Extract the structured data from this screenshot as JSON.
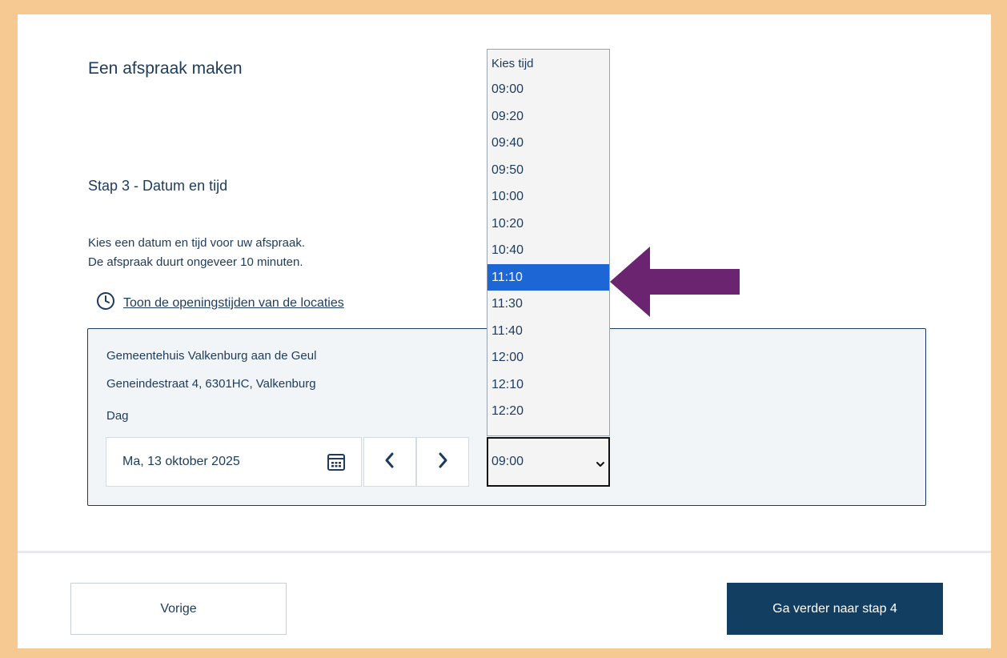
{
  "page": {
    "title": "Een afspraak maken",
    "step_title": "Stap 3 - Datum en tijd",
    "intro_line1": "Kies een datum en tijd voor uw afspraak.",
    "intro_line2": "De afspraak duurt ongeveer 10 minuten.",
    "hours_link": "Toon de openingstijden van de locaties"
  },
  "location": {
    "name": "Gemeentehuis Valkenburg aan de Geul",
    "address": "Geneindestraat 4, 6301HC, Valkenburg",
    "day_label": "Dag",
    "date_value": "Ma, 13 oktober 2025"
  },
  "time_select": {
    "value": "09:00",
    "header": "Kies tijd",
    "highlighted": "11:10",
    "options": [
      "09:00",
      "09:20",
      "09:40",
      "09:50",
      "10:00",
      "10:20",
      "10:40",
      "11:10",
      "11:30",
      "11:40",
      "12:00",
      "12:10",
      "12:20"
    ]
  },
  "footer": {
    "prev_label": "Vorige",
    "next_label": "Ga verder naar stap 4"
  },
  "colors": {
    "brand": "#123e61",
    "highlight": "#1c66d6",
    "annotation_arrow": "#6b2470",
    "border_frame": "#f6c992"
  },
  "icons": {
    "clock": "clock-icon",
    "calendar": "calendar-icon",
    "prev": "chevron-left-icon",
    "next": "chevron-right-icon",
    "dropdown": "chevron-down-icon",
    "arrow": "arrow-left-icon"
  }
}
